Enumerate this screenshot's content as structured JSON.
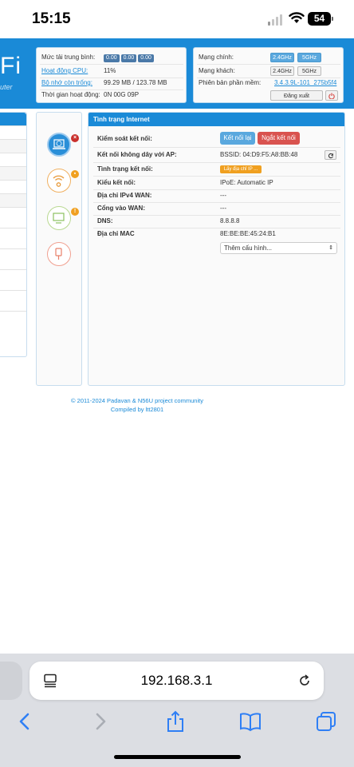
{
  "status_bar": {
    "time": "15:15",
    "battery": "54"
  },
  "header": {
    "logo_text": "Fi",
    "logo_sub": "uter"
  },
  "system": {
    "load_label": "Mức tải trung bình:",
    "load_values": [
      "0.00",
      "0.00",
      "0.00"
    ],
    "cpu_label": "Hoạt động CPU:",
    "cpu_value": "11%",
    "mem_label": "Bộ nhớ còn trống:",
    "mem_value": "99.29 MB / 123.78 MB",
    "uptime_label": "Thời gian hoạt động:",
    "uptime_value": "0N 00G 09P"
  },
  "network": {
    "main_label": "Mạng chính:",
    "guest_label": "Mạng khách:",
    "firmware_label": "Phiên bản phần mềm:",
    "firmware_value": "3.4.3.9L-101_275b5f4",
    "band_24": "2.4GHz",
    "band_5": "5GHz",
    "logout": "Đăng xuất"
  },
  "internet": {
    "title": "Tình trạng Internet",
    "rows": [
      {
        "label": "Kiểm soát kết nối:",
        "value": ""
      },
      {
        "label": "Kết nối không dây với AP:",
        "value": "BSSID: 04:D9:F5:A8:BB:48"
      },
      {
        "label": "Tình trạng kết nối:",
        "value": ""
      },
      {
        "label": "Kiểu kết nối:",
        "value": "IPoE: Automatic IP"
      },
      {
        "label": "Địa chỉ IPv4 WAN:",
        "value": "---"
      },
      {
        "label": "Cổng vào WAN:",
        "value": "---"
      },
      {
        "label": "DNS:",
        "value": "8.8.8.8"
      },
      {
        "label": "Địa chỉ MAC",
        "value": "8E:BE:BE:45:24:B1"
      }
    ],
    "reconnect_button": "Kết nối lại",
    "disconnect_button": "Ngắt kết nối",
    "status_badge": "Lấy địa chỉ IP ...",
    "more_config": "Thêm cấu hình..."
  },
  "footer": {
    "copyright": "© 2011-2024 Padavan & N56U project community",
    "compiled": "Compiled by ltt2801"
  },
  "browser": {
    "url": "192.168.3.1"
  },
  "colors": {
    "accent": "#1a8ad7",
    "danger": "#d9534f",
    "info": "#5aa8de",
    "warning": "#f0a020"
  }
}
